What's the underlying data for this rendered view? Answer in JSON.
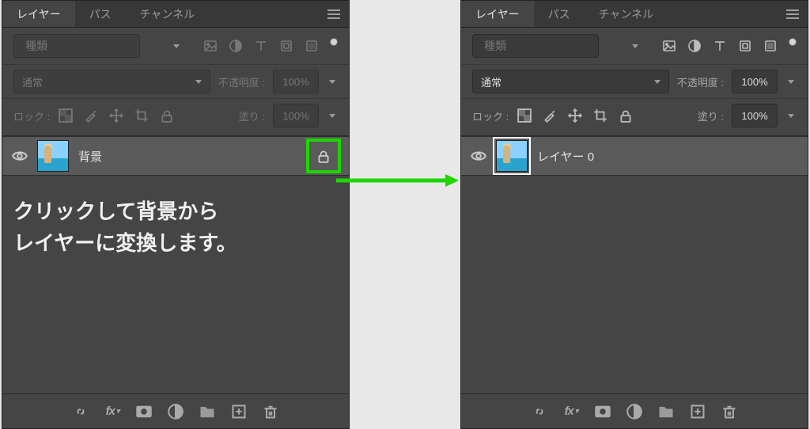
{
  "left": {
    "tabs": {
      "layers": "レイヤー",
      "paths": "パス",
      "channels": "チャンネル"
    },
    "search_placeholder": "種類",
    "blend_mode": "通常",
    "opacity_label": "不透明度 :",
    "opacity_value": "100%",
    "lock_label": "ロック :",
    "fill_label": "塗り :",
    "fill_value": "100%",
    "layer_name": "背景",
    "instruction_line1": "クリックして背景から",
    "instruction_line2": "レイヤーに変換します。",
    "fx_label": "fx"
  },
  "right": {
    "tabs": {
      "layers": "レイヤー",
      "paths": "パス",
      "channels": "チャンネル"
    },
    "search_placeholder": "種類",
    "blend_mode": "通常",
    "opacity_label": "不透明度 :",
    "opacity_value": "100%",
    "lock_label": "ロック :",
    "fill_label": "塗り :",
    "fill_value": "100%",
    "layer_name": "レイヤー 0",
    "fx_label": "fx"
  }
}
